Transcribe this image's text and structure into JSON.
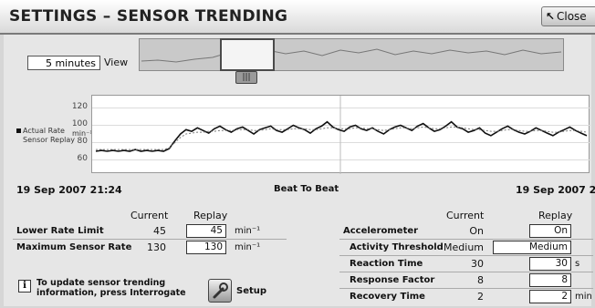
{
  "window": {
    "title": "SETTINGS – SENSOR TRENDING",
    "close_label": "Close"
  },
  "view": {
    "duration_value": "5 minutes",
    "view_label": "View"
  },
  "legend": {
    "line1": "Actual Rate",
    "line2": "Sensor Replay"
  },
  "chart_data": {
    "type": "line",
    "ylabel": "min⁻¹",
    "yticks": [
      120,
      100,
      80,
      60
    ],
    "ylim": [
      50,
      130
    ],
    "series": [
      {
        "name": "Actual Rate",
        "values": [
          70,
          71,
          70,
          71,
          70,
          71,
          70,
          72,
          70,
          71,
          70,
          71,
          70,
          73,
          82,
          90,
          95,
          93,
          97,
          94,
          91,
          96,
          99,
          95,
          92,
          96,
          98,
          94,
          90,
          95,
          97,
          99,
          94,
          92,
          96,
          100,
          97,
          95,
          91,
          96,
          99,
          104,
          98,
          95,
          93,
          98,
          100,
          96,
          94,
          97,
          93,
          90,
          95,
          98,
          100,
          97,
          94,
          99,
          102,
          97,
          93,
          95,
          99,
          104,
          98,
          96,
          92,
          94,
          97,
          91,
          88,
          92,
          96,
          99,
          95,
          92,
          90,
          93,
          97,
          94,
          91,
          88,
          92,
          95,
          98,
          94,
          91,
          88
        ]
      },
      {
        "name": "Sensor Replay",
        "values": [
          72,
          72,
          72,
          72,
          72,
          72,
          72,
          72,
          72,
          72,
          72,
          72,
          72,
          74,
          80,
          86,
          90,
          91,
          92,
          92,
          93,
          93,
          94,
          94,
          94,
          95,
          95,
          95,
          94,
          94,
          95,
          96,
          95,
          95,
          95,
          96,
          96,
          96,
          95,
          95,
          96,
          97,
          97,
          96,
          96,
          96,
          97,
          97,
          96,
          96,
          95,
          94,
          95,
          96,
          97,
          97,
          96,
          97,
          98,
          97,
          96,
          96,
          97,
          98,
          98,
          97,
          96,
          95,
          95,
          94,
          93,
          93,
          94,
          95,
          95,
          94,
          93,
          93,
          94,
          94,
          93,
          92,
          92,
          93,
          94,
          94,
          93,
          92
        ]
      }
    ],
    "x_start": "19 Sep 2007 21:24",
    "x_end": "19 Sep 2007 21:29",
    "x_label": "Beat To Beat"
  },
  "left_table": {
    "col_current": "Current",
    "col_replay": "Replay",
    "rows": [
      {
        "label": "Lower Rate Limit",
        "current": "45",
        "replay": "45",
        "unit": "min⁻¹"
      },
      {
        "label": "Maximum Sensor Rate",
        "current": "130",
        "replay": "130",
        "unit": "min⁻¹"
      }
    ]
  },
  "right_table": {
    "col_current": "Current",
    "col_replay": "Replay",
    "rows": [
      {
        "label": "Accelerometer",
        "current": "On",
        "replay": "On",
        "unit": ""
      },
      {
        "label": "Activity Threshold",
        "current": "Medium",
        "replay": "Medium",
        "unit": ""
      },
      {
        "label": "Reaction Time",
        "current": "30",
        "replay": "30",
        "unit": "s"
      },
      {
        "label": "Response Factor",
        "current": "8",
        "replay": "8",
        "unit": ""
      },
      {
        "label": "Recovery Time",
        "current": "2",
        "replay": "2",
        "unit": "min"
      }
    ]
  },
  "info": {
    "text": "To update sensor trending information, press Interrogate",
    "setup_label": "Setup"
  },
  "colors": {
    "actual": "#111111",
    "replay": "#777777"
  }
}
